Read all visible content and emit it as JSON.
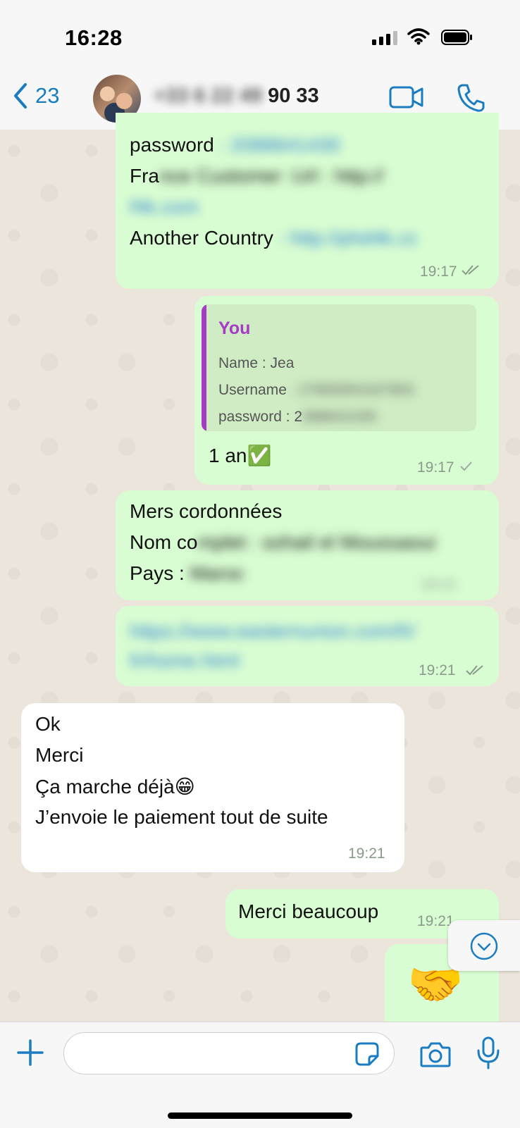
{
  "status_bar": {
    "time": "16:28"
  },
  "header": {
    "back_count": "23",
    "contact_name_hidden": "+33 6 22 49",
    "contact_name_visible": "90 33"
  },
  "messages": {
    "m1": {
      "line1": "password",
      "line1_hidden": ": 2088641430",
      "line2": "Fra",
      "line2_hidden": "nce Customer :Url : http://",
      "line3_hidden": "f4k.com",
      "line4": "Another Country",
      "line4_hidden": ": http://phd4k.cc",
      "time": "19:17"
    },
    "m2": {
      "quote_author": "You",
      "quote_line1": "Name : Jea",
      "quote_line2": "Username",
      "quote_line2_hidden": ": 27665954167903",
      "quote_line3": "password : 2",
      "quote_line3_hidden": "088641430",
      "text": "1 an✅",
      "time": "19:17"
    },
    "m3": {
      "line1": "Mers cordonnées",
      "line2": "Nom co",
      "line2_hidden": "mplet : sohail el Moussaoui",
      "line3": "Pays : ",
      "line3_hidden": "Maroc",
      "time": "19:21"
    },
    "m4": {
      "line1_hidden": "https://www.easternunion.com/fr/",
      "line2_hidden": "fr/home.html",
      "time": "19:21"
    },
    "m5": {
      "line1": "Ok",
      "line2": "Merci",
      "line3": "Ça marche déjà😁",
      "line4": "J’envoie le paiement tout de suite",
      "time": "19:21"
    },
    "m6": {
      "text": "Merci beaucoup",
      "time": "19:21"
    },
    "m7": {
      "emoji": "🤝"
    }
  },
  "input_bar": {
    "placeholder": ""
  },
  "colors": {
    "accent": "#1a7cc1",
    "outgoing_bubble": "#d9fdd3",
    "incoming_bubble": "#ffffff",
    "quote_accent": "#a73bc7"
  }
}
